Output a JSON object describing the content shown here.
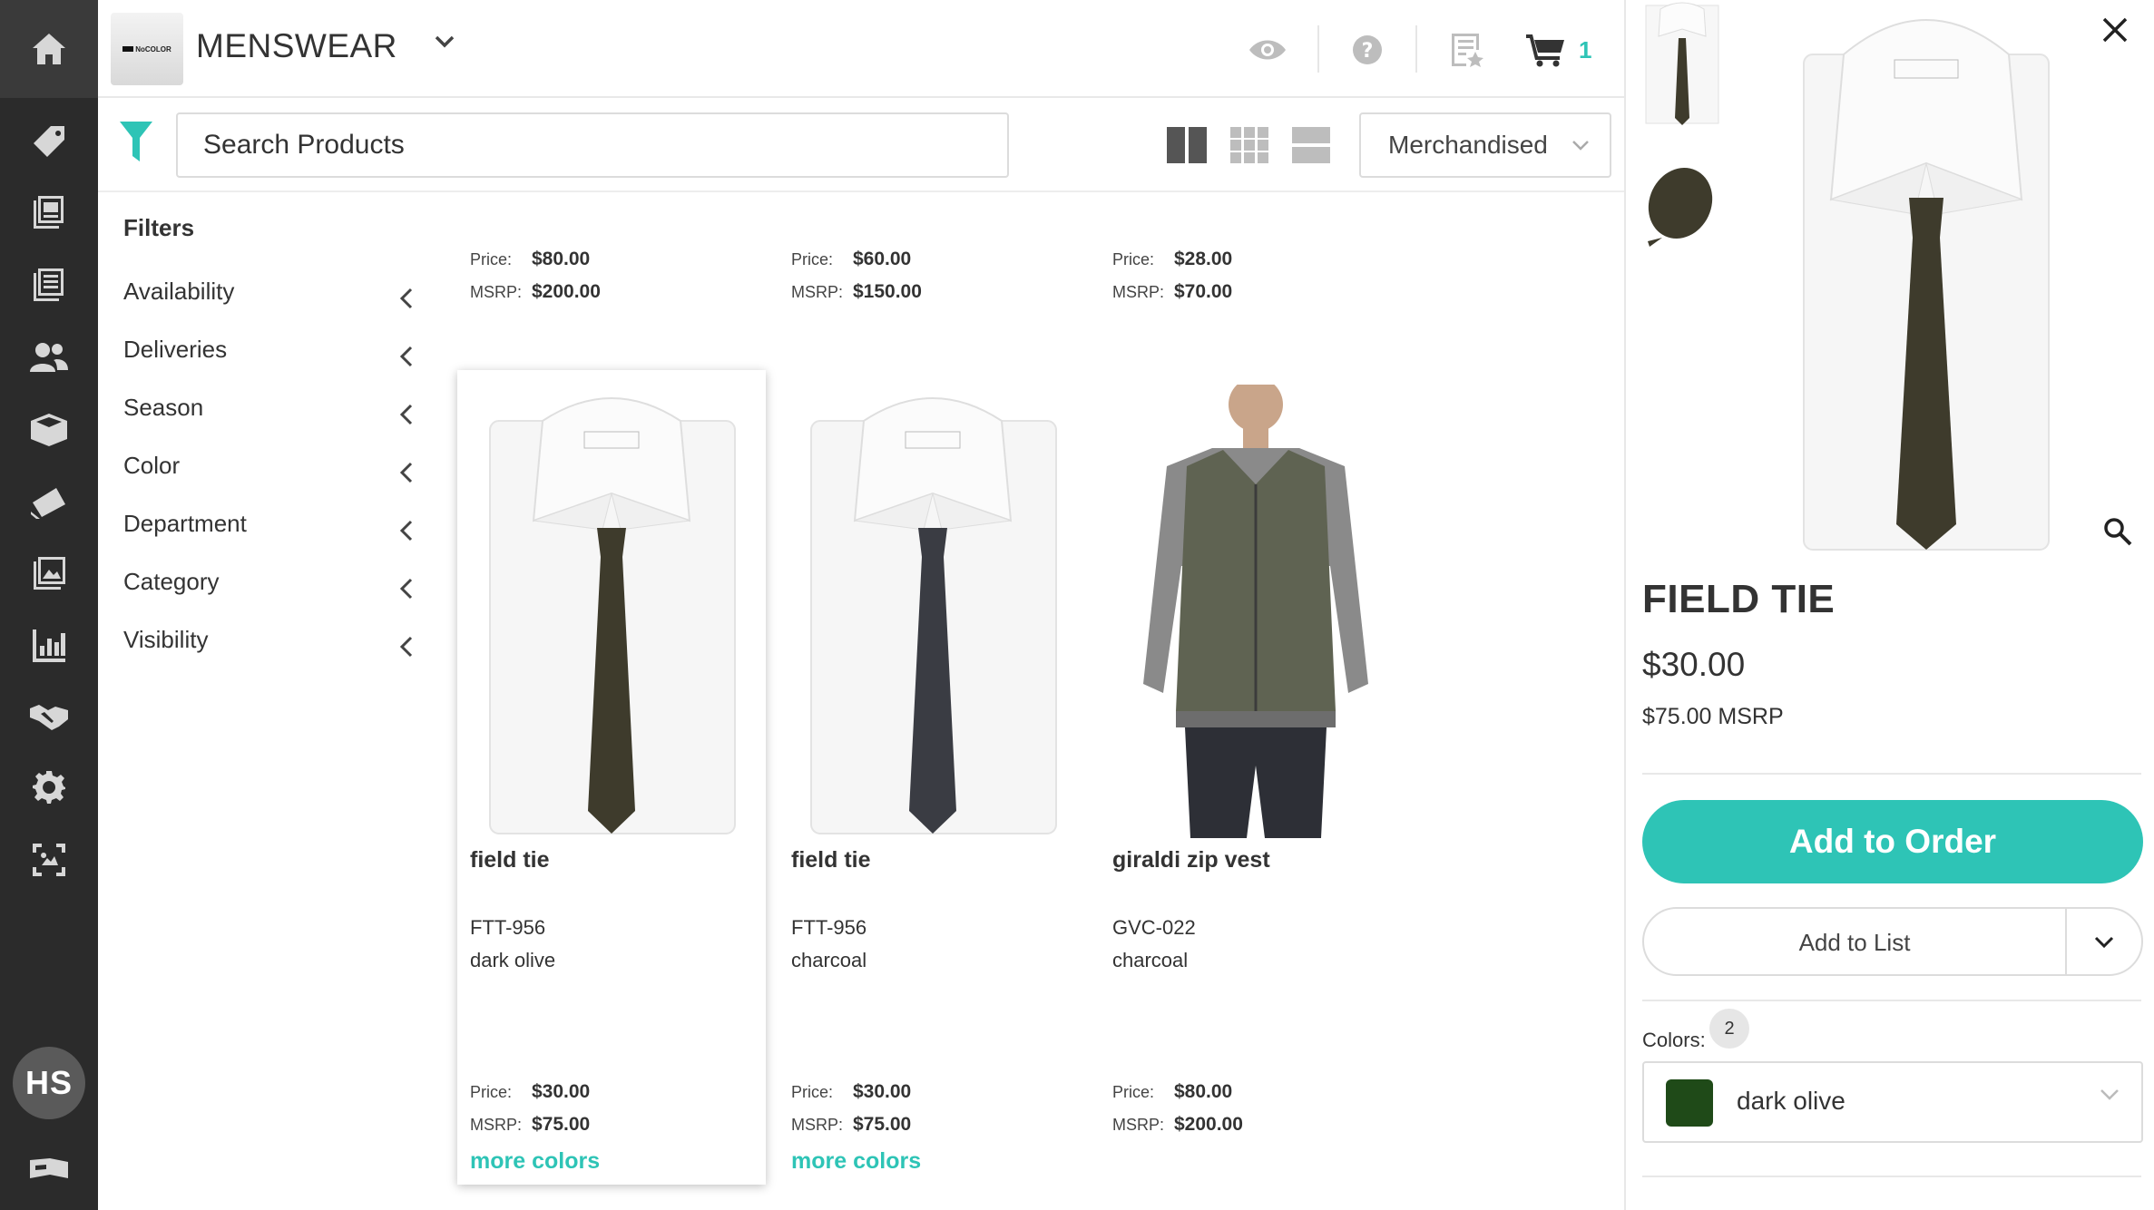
{
  "sidebar": {
    "icons": [
      "home-icon",
      "tag-icon",
      "catalog-icon",
      "linesheet-icon",
      "customers-icon",
      "products-box-icon",
      "campaigns-icon",
      "images-icon",
      "reports-icon",
      "partners-handshake-icon",
      "settings-gear-icon",
      "screen-capture-icon"
    ],
    "avatar_initials": "HS",
    "bottom_icon": "flag-icon"
  },
  "header": {
    "logo_text": "NoCOLOR",
    "store_title": "MENSWEAR",
    "cart_count": "1",
    "icons": [
      "eye-icon",
      "help-icon",
      "list-star-icon",
      "cart-icon"
    ]
  },
  "search": {
    "placeholder": "Search Products",
    "sort_label": "Merchandised",
    "view_modes": [
      "large-grid-icon",
      "small-grid-icon",
      "list-view-icon"
    ]
  },
  "filters": {
    "title": "Filters",
    "items": [
      "Availability",
      "Deliveries",
      "Season",
      "Color",
      "Department",
      "Category",
      "Visibility"
    ]
  },
  "price_labels": {
    "price": "Price:",
    "msrp": "MSRP:"
  },
  "top_row_prices": [
    {
      "price": "$80.00",
      "msrp": "$200.00"
    },
    {
      "price": "$60.00",
      "msrp": "$150.00"
    },
    {
      "price": "$28.00",
      "msrp": "$70.00"
    }
  ],
  "products": [
    {
      "name": "field tie",
      "sku": "FTT-956",
      "color": "dark olive",
      "price": "$30.00",
      "msrp": "$75.00",
      "more": "more colors",
      "tie_color": "#3e3b2c"
    },
    {
      "name": "field tie",
      "sku": "FTT-956",
      "color": "charcoal",
      "price": "$30.00",
      "msrp": "$75.00",
      "more": "more colors",
      "tie_color": "#3a3c43"
    },
    {
      "name": "giraldi zip vest",
      "sku": "GVC-022",
      "color": "charcoal",
      "price": "$80.00",
      "msrp": "$200.00",
      "more": ""
    }
  ],
  "detail": {
    "title": "FIELD TIE",
    "price": "$30.00",
    "msrp": "$75.00 MSRP",
    "add_to_order": "Add to Order",
    "add_to_list": "Add to List",
    "colors_label": "Colors:",
    "colors_count": "2",
    "selected_color": "dark olive",
    "selected_swatch": "#1f4a18",
    "accent": "#2ec4b6"
  }
}
